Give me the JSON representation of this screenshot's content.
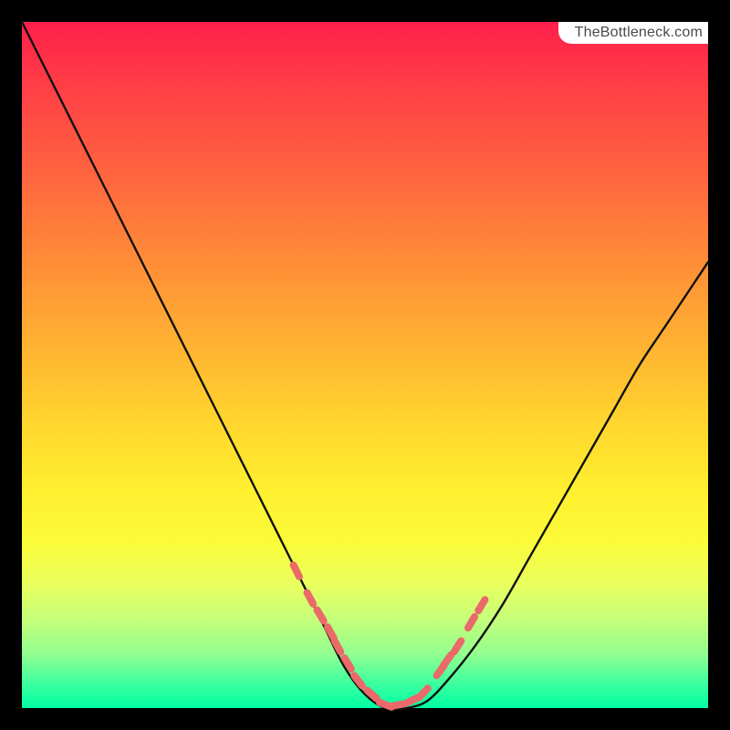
{
  "watermark": {
    "text": "TheBottleneck.com"
  },
  "colors": {
    "background": "#000000",
    "gradient_top": "#ff1f4a",
    "gradient_mid1": "#ff8d37",
    "gradient_mid2": "#ffef2f",
    "gradient_bottom": "#00ffa3",
    "curve": "#111111",
    "marker": "#ea6a6a"
  },
  "chart_data": {
    "type": "line",
    "title": "",
    "xlabel": "",
    "ylabel": "",
    "xlim": [
      0,
      100
    ],
    "ylim": [
      0,
      100
    ],
    "series": [
      {
        "name": "bottleneck-curve",
        "x": [
          0,
          4,
          8,
          12,
          16,
          20,
          24,
          28,
          32,
          36,
          40,
          44,
          47,
          50,
          53,
          56,
          59,
          62,
          66,
          70,
          74,
          78,
          82,
          86,
          90,
          94,
          98,
          100
        ],
        "y": [
          100,
          92,
          84,
          76,
          68,
          60,
          52,
          44,
          36,
          28,
          20,
          12,
          6,
          2,
          0,
          0,
          1,
          4,
          9,
          15,
          22,
          29,
          36,
          43,
          50,
          56,
          62,
          65
        ]
      }
    ],
    "markers": {
      "name": "highlight-dots",
      "x": [
        40,
        42,
        43.5,
        45,
        46,
        47.5,
        49,
        51,
        53,
        55,
        57,
        58.5,
        61,
        62,
        63.5,
        65.5,
        67
      ],
      "y": [
        20,
        16,
        13.5,
        11,
        9,
        6.5,
        4,
        2,
        0.5,
        0.5,
        1.2,
        2.2,
        5.5,
        7,
        9,
        12.5,
        15
      ]
    }
  }
}
